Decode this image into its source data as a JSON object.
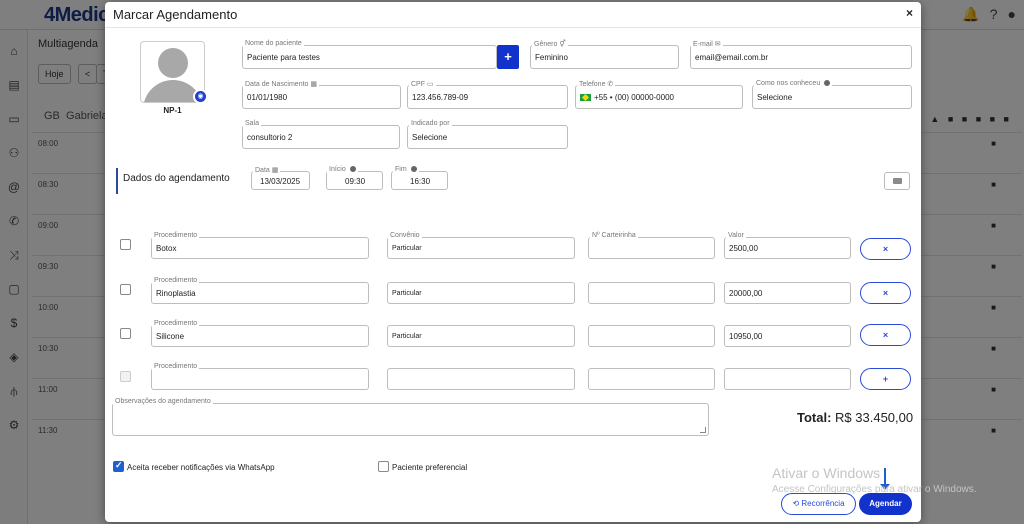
{
  "background": {
    "logo": "4Medic",
    "title": "Multiagenda",
    "buttons": [
      "Hoje",
      "<",
      "T"
    ],
    "gb_label": "GB",
    "gb_name": "Gabriela",
    "times": [
      "08:00",
      "08:30",
      "09:00",
      "09:30",
      "10:00",
      "10:30",
      "11:00",
      "11:30"
    ]
  },
  "modal": {
    "title": "Marcar Agendamento",
    "close": "×"
  },
  "patient": {
    "avatar_id": "NP-1",
    "nome_label": "Nome do paciente",
    "nome_value": "Paciente para testes",
    "add_button": "+",
    "genero_label": "Gênero",
    "genero_value": "Feminino",
    "email_label": "E-mail",
    "email_value": "email@email.com.br",
    "nasc_label": "Data de Nascimento",
    "nasc_value": "01/01/1980",
    "cpf_label": "CPF",
    "cpf_value": "123.456.789-09",
    "tel_label": "Telefone",
    "tel_value": "+55 •  (00) 00000-0000",
    "como_label": "Como nos conheceu",
    "como_value": "Selecione",
    "sala_label": "Sala",
    "sala_value": "consultorio 2",
    "indicado_label": "Indicado por",
    "indicado_value": "Selecione"
  },
  "agendamento": {
    "section_title": "Dados do agendamento",
    "data_label": "Data",
    "data_value": "13/03/2025",
    "inicio_label": "Início",
    "inicio_value": "09:30",
    "fim_label": "Fim",
    "fim_value": "16:30"
  },
  "procedures": {
    "procedimento_label": "Procedimento",
    "convenio_label": "Convênio",
    "carteirinha_label": "Nº Carteirinha",
    "valor_label": "Valor",
    "rows": [
      {
        "procedimento": "Botox",
        "convenio": "Particular",
        "valor": "2500,00",
        "action": "×"
      },
      {
        "procedimento": "Rinoplastia",
        "convenio": "Particular",
        "valor": "20000,00",
        "action": "×"
      },
      {
        "procedimento": "Silicone",
        "convenio": "Particular",
        "valor": "10950,00",
        "action": "×"
      }
    ],
    "add_action": "+"
  },
  "observacoes_label": "Observações do agendamento",
  "total_label": "Total:",
  "total_value": "R$ 33.450,00",
  "whatsapp_label": "Aceita receber notificações via WhatsApp",
  "preferencial_label": "Paciente preferencial",
  "watermark_title": "Ativar o Windows",
  "watermark_sub": "Acesse Configurações para ativar o Windows.",
  "buttons": {
    "recorrencia": "Recorrência",
    "agendar": "Agendar"
  },
  "colors": {
    "primary": "#1133cc",
    "outline": "#2a4ad8"
  }
}
